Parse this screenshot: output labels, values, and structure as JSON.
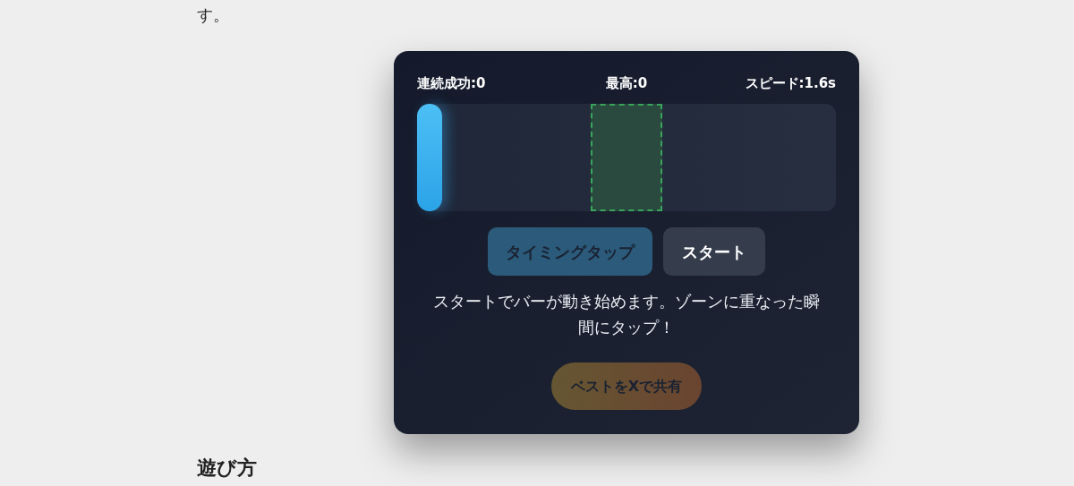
{
  "intro_tail": "す。",
  "game": {
    "stats": [
      {
        "label": "連続成功:0"
      },
      {
        "label": "最高:0"
      },
      {
        "label": "スピード:1.6s"
      }
    ],
    "track": {
      "level": 0
    },
    "buttons": [
      {
        "label": "タイミングタップ",
        "kind": "primary",
        "disabled": true
      },
      {
        "label": "スタート",
        "kind": "secondary",
        "disabled": false
      }
    ],
    "instruction": "スタートでバーが動き始めます。ゾーンに重なった瞬間にタップ！",
    "share_button": {
      "label": "ベストをXで共有",
      "disabled": true
    }
  },
  "next_heading": "遊び方"
}
